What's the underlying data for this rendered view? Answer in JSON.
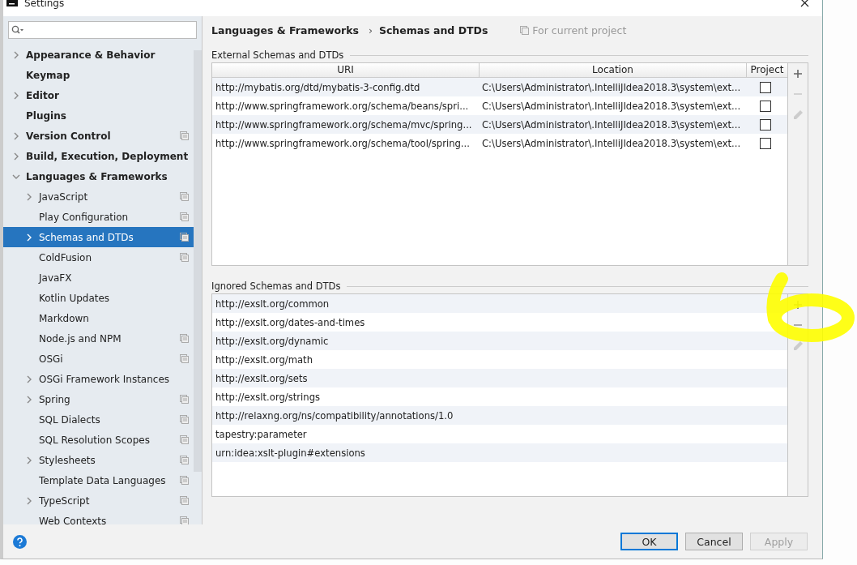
{
  "window": {
    "title": "Settings"
  },
  "sidebar": {
    "items": [
      {
        "label": "Appearance & Behavior",
        "expandable": true,
        "expanded": false,
        "project_scoped": false,
        "selected": false
      },
      {
        "label": "Keymap",
        "expandable": false,
        "project_scoped": false,
        "selected": false
      },
      {
        "label": "Editor",
        "expandable": true,
        "expanded": false,
        "project_scoped": false,
        "selected": false
      },
      {
        "label": "Plugins",
        "expandable": false,
        "project_scoped": false,
        "selected": false
      },
      {
        "label": "Version Control",
        "expandable": true,
        "expanded": false,
        "project_scoped": true,
        "selected": false
      },
      {
        "label": "Build, Execution, Deployment",
        "expandable": true,
        "expanded": false,
        "project_scoped": false,
        "selected": false
      },
      {
        "label": "Languages & Frameworks",
        "expandable": true,
        "expanded": true,
        "project_scoped": false,
        "selected": false,
        "children": [
          {
            "label": "JavaScript",
            "expandable": true,
            "expanded": false,
            "project_scoped": true,
            "selected": false
          },
          {
            "label": "Play Configuration",
            "expandable": false,
            "project_scoped": true,
            "selected": false
          },
          {
            "label": "Schemas and DTDs",
            "expandable": true,
            "expanded": false,
            "project_scoped": true,
            "selected": true
          },
          {
            "label": "ColdFusion",
            "expandable": false,
            "project_scoped": true,
            "selected": false
          },
          {
            "label": "JavaFX",
            "expandable": false,
            "project_scoped": false,
            "selected": false
          },
          {
            "label": "Kotlin Updates",
            "expandable": false,
            "project_scoped": false,
            "selected": false
          },
          {
            "label": "Markdown",
            "expandable": false,
            "project_scoped": false,
            "selected": false
          },
          {
            "label": "Node.js and NPM",
            "expandable": false,
            "project_scoped": true,
            "selected": false
          },
          {
            "label": "OSGi",
            "expandable": false,
            "project_scoped": true,
            "selected": false
          },
          {
            "label": "OSGi Framework Instances",
            "expandable": true,
            "expanded": false,
            "project_scoped": false,
            "selected": false
          },
          {
            "label": "Spring",
            "expandable": true,
            "expanded": false,
            "project_scoped": true,
            "selected": false
          },
          {
            "label": "SQL Dialects",
            "expandable": false,
            "project_scoped": true,
            "selected": false
          },
          {
            "label": "SQL Resolution Scopes",
            "expandable": false,
            "project_scoped": true,
            "selected": false
          },
          {
            "label": "Stylesheets",
            "expandable": true,
            "expanded": false,
            "project_scoped": true,
            "selected": false
          },
          {
            "label": "Template Data Languages",
            "expandable": false,
            "project_scoped": true,
            "selected": false
          },
          {
            "label": "TypeScript",
            "expandable": true,
            "expanded": false,
            "project_scoped": true,
            "selected": false
          },
          {
            "label": "Web Contexts",
            "expandable": false,
            "project_scoped": true,
            "selected": false
          }
        ]
      }
    ]
  },
  "breadcrumb": {
    "parent": "Languages & Frameworks",
    "separator": "›",
    "current": "Schemas and DTDs",
    "scope": "For current project"
  },
  "external": {
    "title": "External Schemas and DTDs",
    "columns": [
      "URI",
      "Location",
      "Project"
    ],
    "rows": [
      {
        "uri": "http://mybatis.org/dtd/mybatis-3-config.dtd",
        "location": "C:\\Users\\Administrator\\.IntelliJIdea2018.3\\system\\ext...",
        "checked": false
      },
      {
        "uri": "http://www.springframework.org/schema/beans/spri...",
        "location": "C:\\Users\\Administrator\\.IntelliJIdea2018.3\\system\\ext...",
        "checked": false
      },
      {
        "uri": "http://www.springframework.org/schema/mvc/spring...",
        "location": "C:\\Users\\Administrator\\.IntelliJIdea2018.3\\system\\ext...",
        "checked": false
      },
      {
        "uri": "http://www.springframework.org/schema/tool/spring...",
        "location": "C:\\Users\\Administrator\\.IntelliJIdea2018.3\\system\\ext...",
        "checked": false
      }
    ]
  },
  "ignored": {
    "title": "Ignored Schemas and DTDs",
    "rows": [
      "http://exslt.org/common",
      "http://exslt.org/dates-and-times",
      "http://exslt.org/dynamic",
      "http://exslt.org/math",
      "http://exslt.org/sets",
      "http://exslt.org/strings",
      "http://relaxng.org/ns/compatibility/annotations/1.0",
      "tapestry:parameter",
      "urn:idea:xslt-plugin#extensions"
    ]
  },
  "buttons": [
    {
      "label": "OK",
      "default": true,
      "disabled": false
    },
    {
      "label": "Cancel",
      "default": false,
      "disabled": false
    },
    {
      "label": "Apply",
      "default": false,
      "disabled": true
    }
  ]
}
